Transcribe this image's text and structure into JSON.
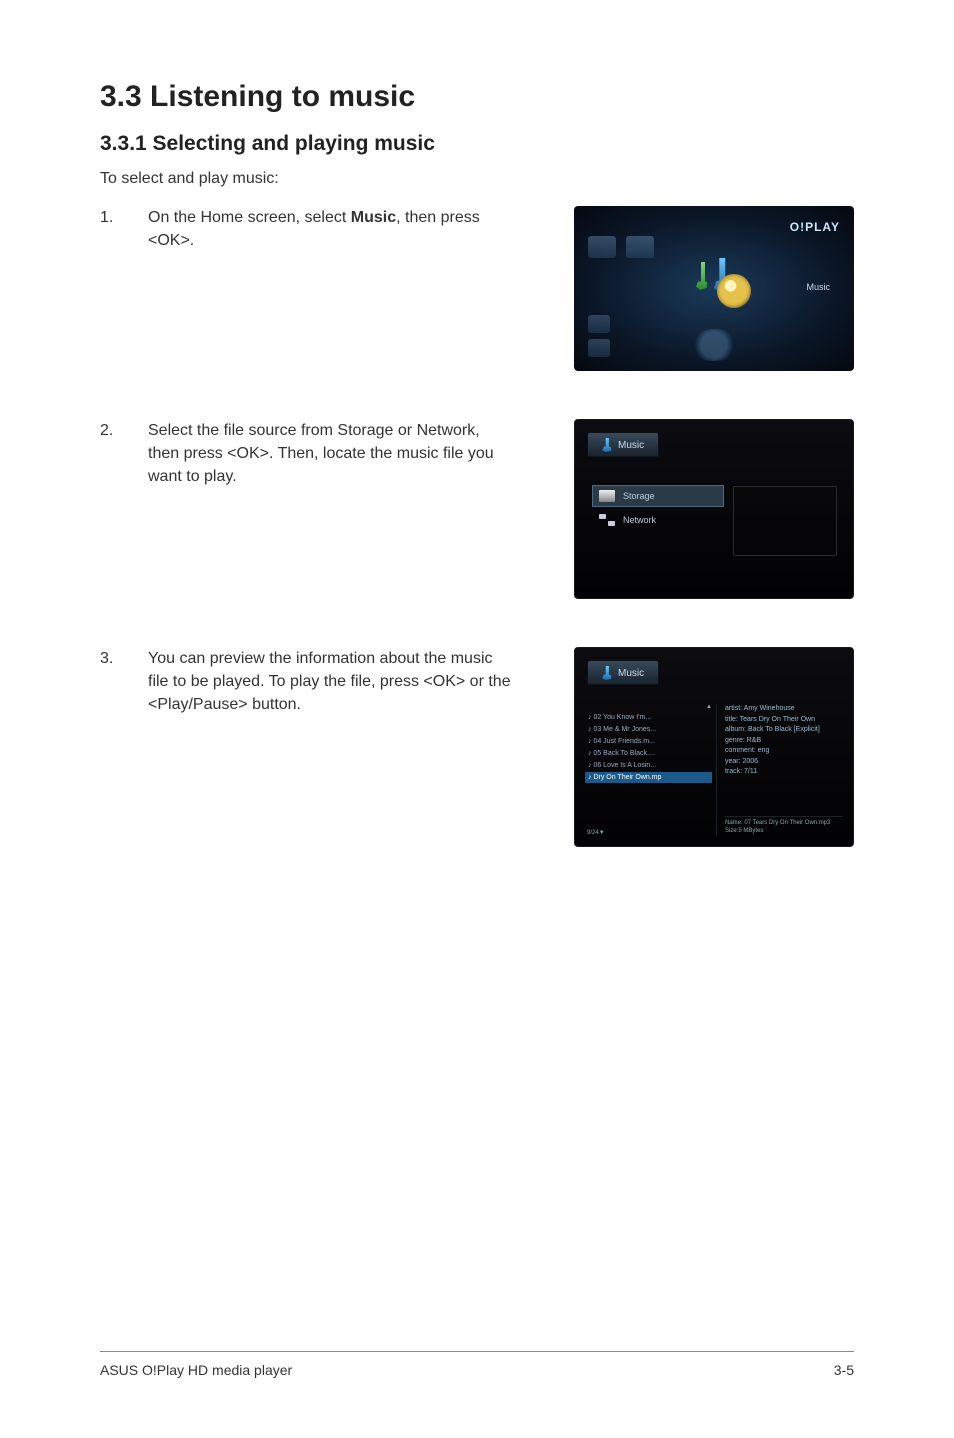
{
  "heading": "3.3    Listening to music",
  "subheading": "3.3.1      Selecting and playing music",
  "intro": "To select and play music:",
  "steps": [
    {
      "num": "1.",
      "pre": "On the Home screen, select ",
      "bold": "Music",
      "post": ", then press <OK>."
    },
    {
      "num": "2.",
      "text": "Select the file source from Storage or Network, then press <OK>. Then, locate the music file you want to play."
    },
    {
      "num": "3.",
      "text": "You can preview the information about the music file to be played. To play the file, press <OK> or the <Play/Pause> button."
    }
  ],
  "shot1": {
    "logo": "O!PLAY",
    "label": "Music"
  },
  "shot2": {
    "tab": "Music",
    "items": [
      {
        "label": "Storage",
        "selected": true,
        "icon": "drive"
      },
      {
        "label": "Network",
        "selected": false,
        "icon": "net"
      }
    ]
  },
  "shot3": {
    "tab": "Music",
    "tracks": [
      {
        "label": "♪ 02 You Know I'm...",
        "selected": false
      },
      {
        "label": "♪ 03 Me & Mr Jones...",
        "selected": false
      },
      {
        "label": "♪ 04 Just Friends.m...",
        "selected": false
      },
      {
        "label": "♪ 05 Back To Black....",
        "selected": false
      },
      {
        "label": "♪ 06 Love Is A Losin...",
        "selected": false
      },
      {
        "label": "♪ Dry On Their Own.mp",
        "selected": true
      }
    ],
    "meta": {
      "artist": "artist: Amy Winehouse",
      "title": "title: Tears Dry On Their Own",
      "album": "album: Back To Black [Explicit]",
      "genre": "genre: R&B",
      "comment": "comment: eng",
      "year": "year: 2006",
      "track": "track: 7/11"
    },
    "file": {
      "name": "Name: 07 Tears Dry On Their Own.mp3",
      "size": "Size:5 MBytes"
    },
    "pos": "9/24"
  },
  "footer": {
    "left": "ASUS O!Play HD media player",
    "right": "3-5"
  }
}
